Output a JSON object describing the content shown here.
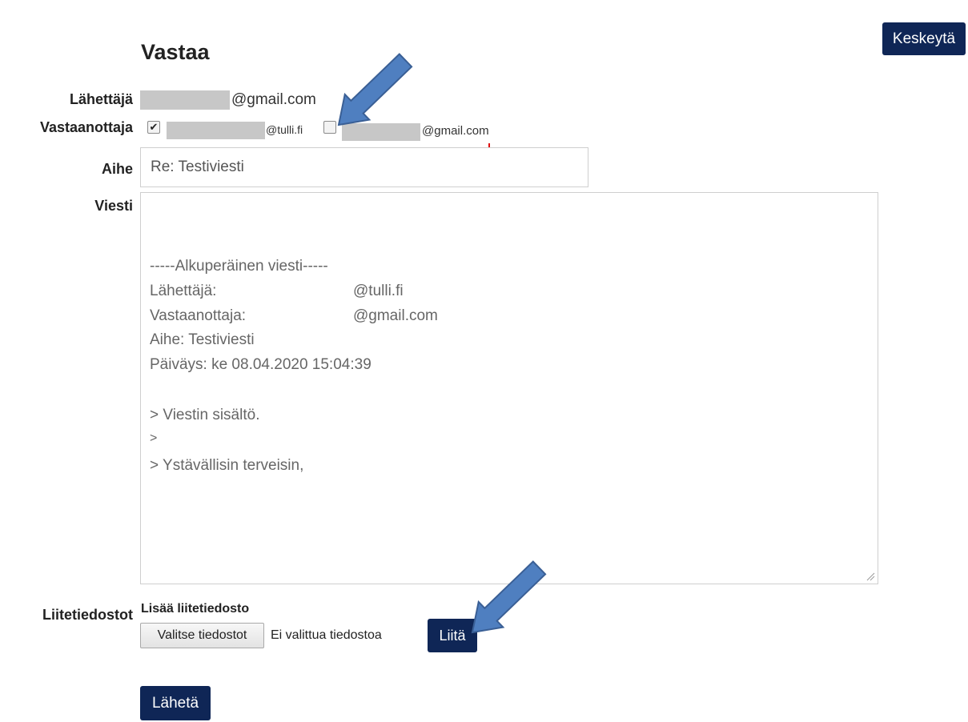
{
  "page": {
    "title": "Vastaa",
    "cancel_button": "Keskeytä"
  },
  "form": {
    "sender_label": "Lähettäjä",
    "sender_email_suffix": "@gmail.com",
    "recipient_label": "Vastaanottaja",
    "recipients": [
      {
        "suffix": "@tulli.fi",
        "checked": true
      },
      {
        "suffix": "@gmail.com",
        "checked": false
      }
    ],
    "subject_label": "Aihe",
    "subject_value": "Re: Testiviesti",
    "message_label": "Viesti",
    "message_lines": [
      "-----Alkuperäinen viesti-----",
      "Lähettäjä:",
      "@tulli.fi",
      "Vastaanottaja:",
      "@gmail.com",
      "Aihe: Testiviesti",
      "Päiväys: ke 08.04.2020 15:04:39",
      "> Viestin sisältö.",
      ">",
      "> Ystävällisin terveisin,"
    ],
    "attachments_label": "Liitetiedostot",
    "add_attachment_label": "Lisää liitetiedosto",
    "choose_files_button": "Valitse tiedostot",
    "no_file_text": "Ei valittua tiedostoa",
    "attach_button": "Liitä",
    "send_button": "Lähetä"
  },
  "colors": {
    "button_navy": "#0f2656",
    "arrow_blue": "#4f7fc0",
    "arrow_outline": "#3a5f95"
  }
}
